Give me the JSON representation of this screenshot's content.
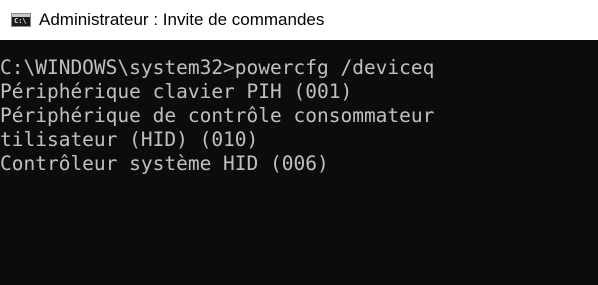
{
  "window": {
    "title": "Administrateur : Invite de commandes",
    "icon": "cmd-icon",
    "icon_glyph": "C:\\",
    "background_color": "#0c0c0c",
    "text_color": "#c0c0c0"
  },
  "console": {
    "lines": [
      "C:\\WINDOWS\\system32>powercfg /deviceq",
      "Périphérique clavier PIH (001)",
      "Périphérique de contrôle consommateur",
      "tilisateur (HID) (010)",
      "Contrôleur système HID (006)"
    ]
  }
}
